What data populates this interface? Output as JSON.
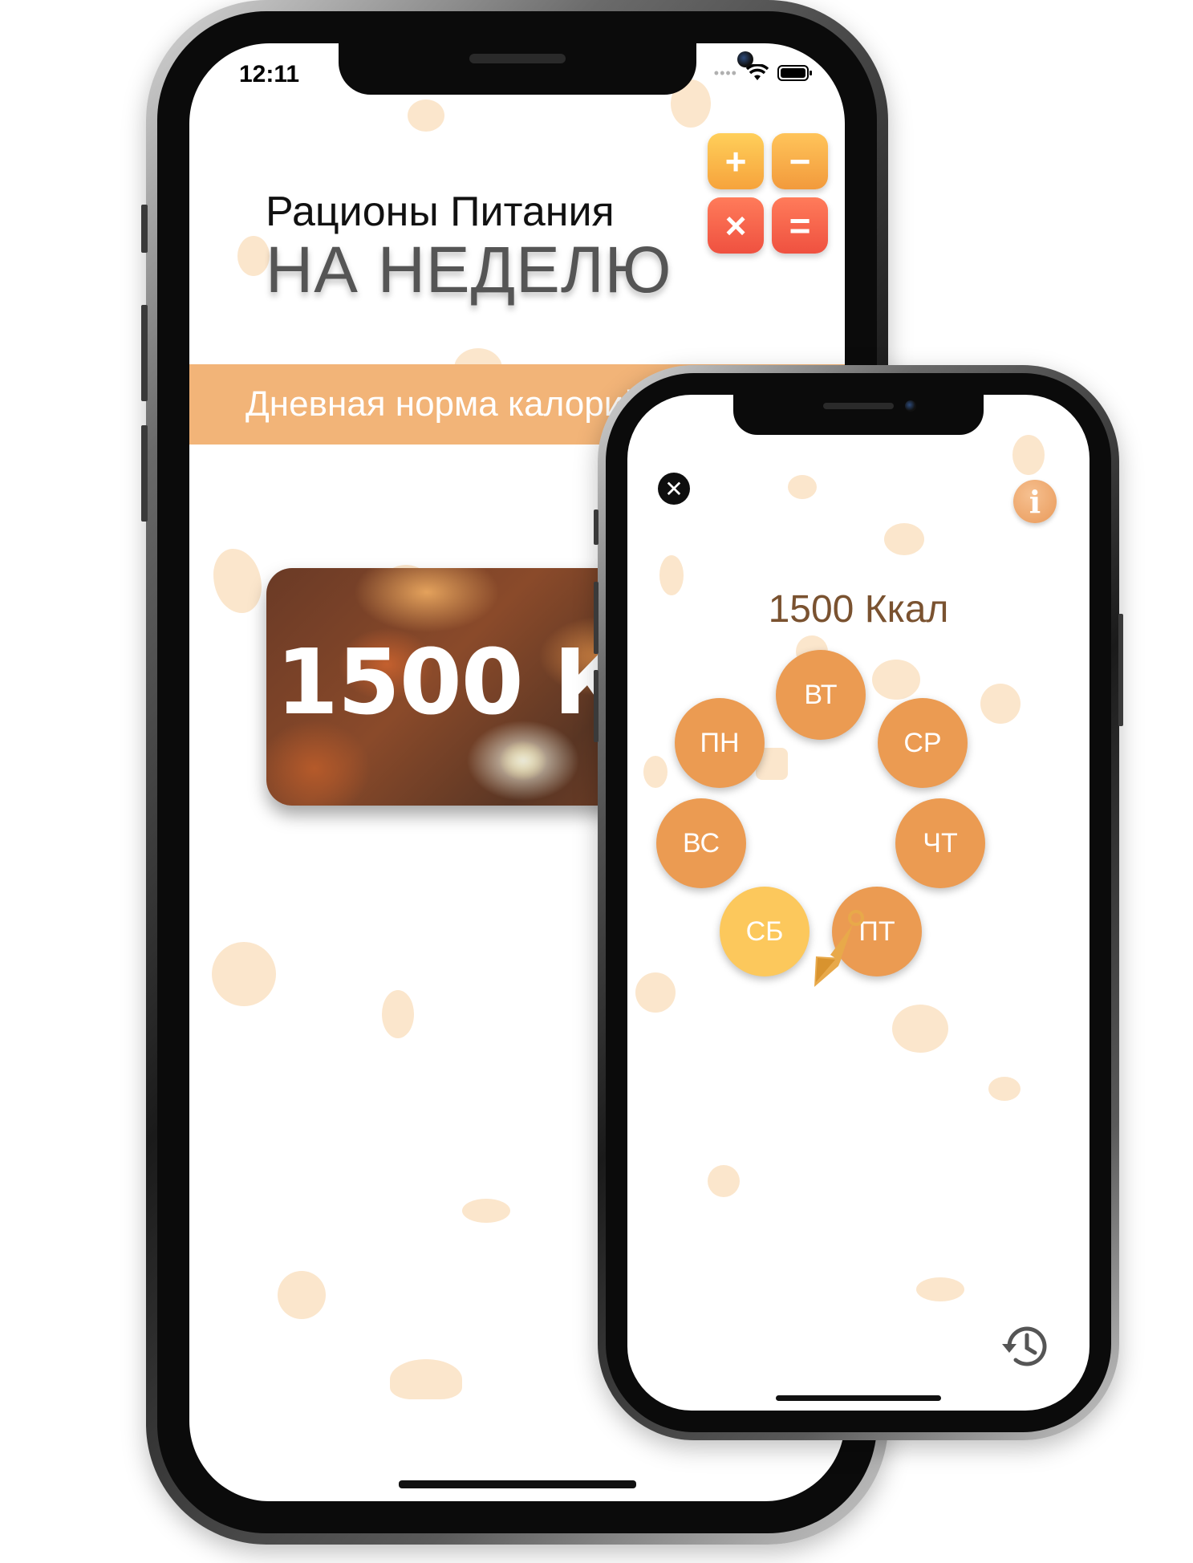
{
  "big_phone": {
    "status_time": "12:11",
    "title_line1": "Рационы Питания",
    "title_line2": "НА НЕДЕЛЮ",
    "calculator_keys": [
      "+",
      "−",
      "×",
      "="
    ],
    "banner_text": "Дневная норма калорий",
    "card_text": "1500 ККАЛ"
  },
  "small_phone": {
    "kcal": "1500 Ккал",
    "close_icon": "close-icon",
    "info_label": "i",
    "days": [
      {
        "label": "ПН",
        "active": false
      },
      {
        "label": "ВТ",
        "active": false
      },
      {
        "label": "СР",
        "active": false
      },
      {
        "label": "ЧТ",
        "active": false
      },
      {
        "label": "ПТ",
        "active": false
      },
      {
        "label": "СБ",
        "active": true
      },
      {
        "label": "ВС",
        "active": false
      }
    ]
  },
  "colors": {
    "banner": "#f2b478",
    "day_button": "#eb9b52",
    "day_active": "#fcc85c",
    "kcal_text": "#7a5230"
  }
}
